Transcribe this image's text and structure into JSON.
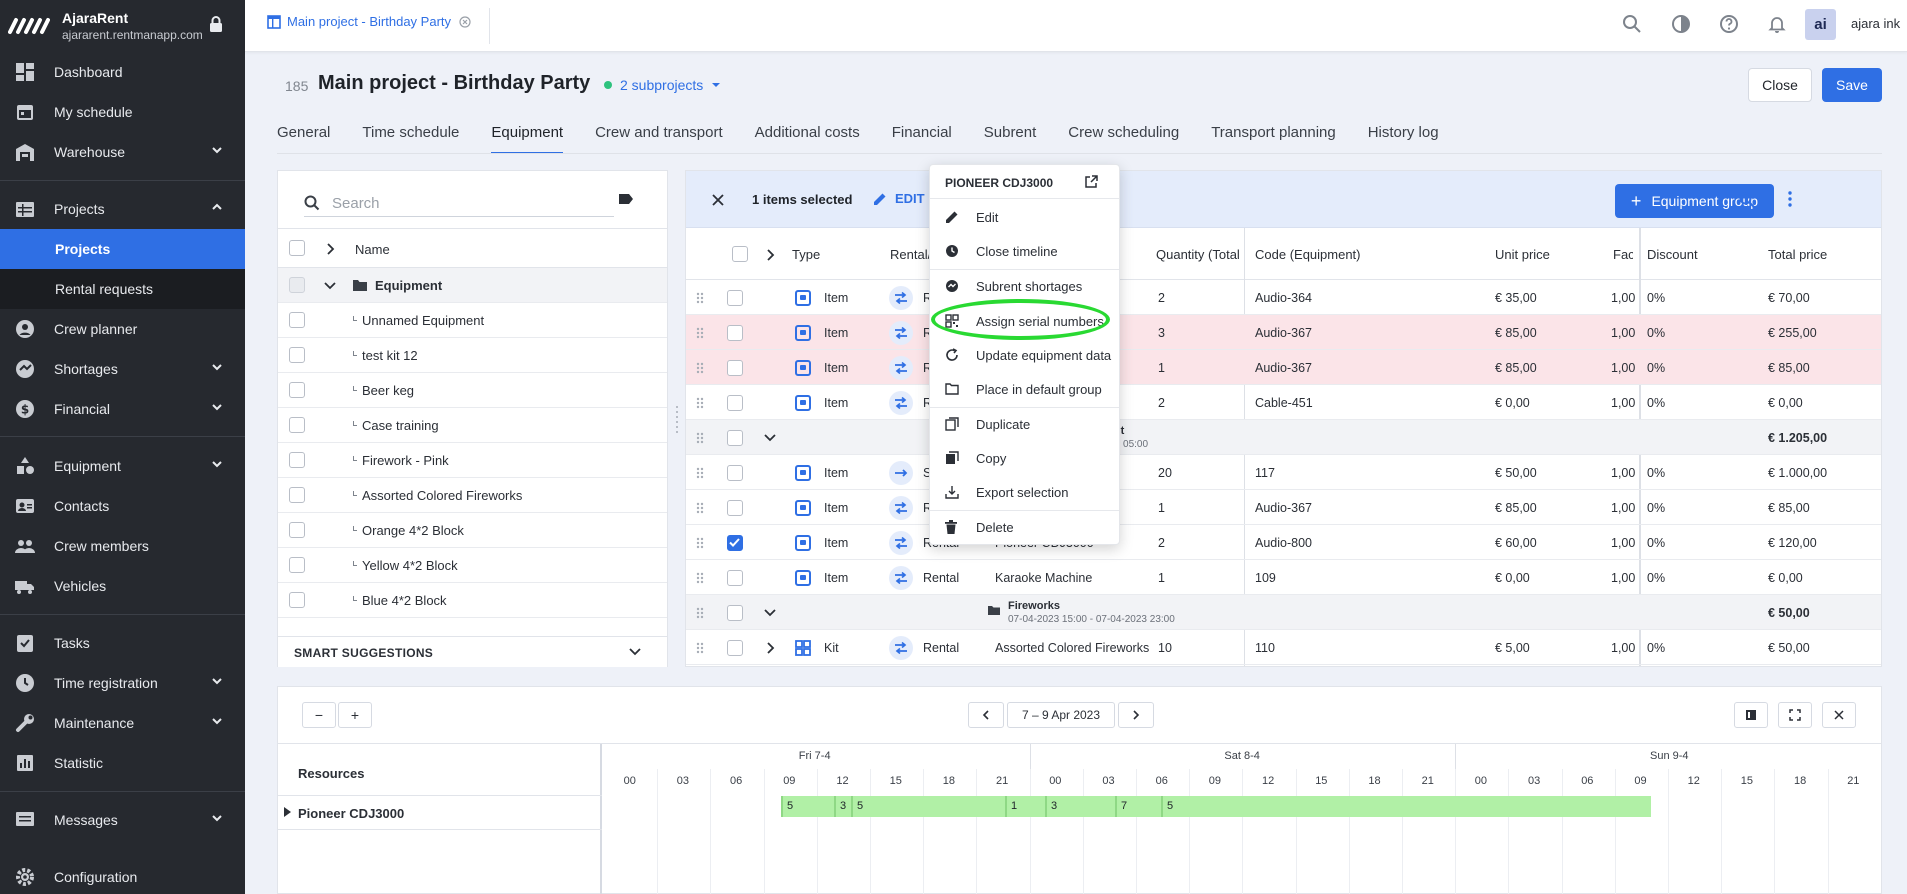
{
  "sidebar": {
    "brand_name": "AjaraRent",
    "brand_url": "ajararent.rentmanapp.com",
    "items": [
      {
        "label": "Dashboard"
      },
      {
        "label": "My schedule"
      },
      {
        "label": "Warehouse"
      },
      {
        "label": "Projects"
      },
      {
        "label": "Projects"
      },
      {
        "label": "Rental requests"
      },
      {
        "label": "Crew planner"
      },
      {
        "label": "Shortages"
      },
      {
        "label": "Financial"
      },
      {
        "label": "Equipment"
      },
      {
        "label": "Contacts"
      },
      {
        "label": "Crew members"
      },
      {
        "label": "Vehicles"
      },
      {
        "label": "Tasks"
      },
      {
        "label": "Time registration"
      },
      {
        "label": "Maintenance"
      },
      {
        "label": "Statistic"
      },
      {
        "label": "Messages"
      },
      {
        "label": "Configuration"
      }
    ]
  },
  "topbar": {
    "open_tab": "Main project - Birthday Party",
    "avatar_initials": "ai",
    "user_name": "ajara ink"
  },
  "project": {
    "number": "185",
    "title": "Main project - Birthday Party",
    "subprojects": "2 subprojects",
    "close_label": "Close",
    "save_label": "Save"
  },
  "tabs": [
    "General",
    "Time schedule",
    "Equipment",
    "Crew and transport",
    "Additional costs",
    "Financial",
    "Subrent",
    "Crew scheduling",
    "Transport planning",
    "History log"
  ],
  "left_panel": {
    "search_placeholder": "Search",
    "header_name": "Name",
    "group": "Equipment",
    "items": [
      "Unnamed Equipment",
      "test kit 12",
      "Beer keg",
      "Case training",
      "Firework - Pink",
      "Assorted Colored Fireworks",
      "Orange 4*2 Block",
      "Yellow 4*2 Block",
      "Blue 4*2 Block"
    ],
    "smart_suggestions": "SMART SUGGESTIONS"
  },
  "selection_bar": {
    "count": "1 items selected",
    "edit": "EDIT",
    "equipment_group_button": "Equipment group"
  },
  "table": {
    "headers": {
      "type": "Type",
      "rental": "Rental/",
      "quantity": "Quantity (Total",
      "code": "Code (Equipment)",
      "unit_price": "Unit price",
      "factor": "Facto",
      "discount": "Discount",
      "total": "Total price"
    },
    "rows": [
      {
        "type": "Item",
        "rental": "R",
        "name": "…",
        "qty": "2",
        "code": "Audio-364",
        "unit": "€ 35,00",
        "factor": "1,00",
        "discount": "0%",
        "total": "€ 70,00",
        "red": false,
        "checked": false
      },
      {
        "type": "Item",
        "rental": "R",
        "name": "",
        "qty": "3",
        "code": "Audio-367",
        "unit": "€ 85,00",
        "factor": "1,00",
        "discount": "0%",
        "total": "€ 255,00",
        "red": true,
        "checked": false
      },
      {
        "type": "Item",
        "rental": "R",
        "name": "",
        "qty": "1",
        "code": "Audio-367",
        "unit": "€ 85,00",
        "factor": "1,00",
        "discount": "0%",
        "total": "€ 85,00",
        "red": true,
        "checked": false
      },
      {
        "type": "Item",
        "rental": "R",
        "name": "",
        "qty": "2",
        "code": "Cable-451",
        "unit": "€ 0,00",
        "factor": "1,00",
        "discount": "0%",
        "total": "€ 0,00",
        "red": false,
        "checked": false
      },
      {
        "group": true,
        "name": "ment",
        "date": "2023 05:00",
        "total": "€ 1.205,00"
      },
      {
        "type": "Item",
        "rental": "S",
        "name": "",
        "qty": "20",
        "code": "117",
        "unit": "€ 50,00",
        "factor": "1,00",
        "discount": "0%",
        "total": "€ 1.000,00",
        "red": false,
        "checked": false
      },
      {
        "type": "Item",
        "rental": "R",
        "name": "",
        "qty": "1",
        "code": "Audio-367",
        "unit": "€ 85,00",
        "factor": "1,00",
        "discount": "0%",
        "total": "€ 85,00",
        "red": false,
        "checked": false
      },
      {
        "type": "Item",
        "rental": "Rental",
        "name": "Pioneer CDJ3000",
        "qty": "2",
        "code": "Audio-800",
        "unit": "€ 60,00",
        "factor": "1,00",
        "discount": "0%",
        "total": "€ 120,00",
        "red": false,
        "checked": true
      },
      {
        "type": "Item",
        "rental": "Rental",
        "name": "Karaoke Machine",
        "qty": "1",
        "code": "109",
        "unit": "€ 0,00",
        "factor": "1,00",
        "discount": "0%",
        "total": "€ 0,00",
        "red": false,
        "checked": false
      },
      {
        "group": true,
        "name": "Fireworks",
        "date": "07-04-2023 15:00 - 07-04-2023 23:00",
        "total": "€ 50,00"
      },
      {
        "type": "Kit",
        "rental": "Rental",
        "name": "Assorted Colored Fireworks",
        "qty": "10",
        "code": "110",
        "unit": "€ 5,00",
        "factor": "1,00",
        "discount": "0%",
        "total": "€ 50,00",
        "red": false,
        "checked": false
      }
    ]
  },
  "context_menu": {
    "title": "PIONEER CDJ3000",
    "items": [
      "Edit",
      "Close timeline",
      "Subrent shortages",
      "Assign serial numbers",
      "Update equipment data",
      "Place in default group",
      "Duplicate",
      "Copy",
      "Export selection",
      "Delete"
    ]
  },
  "timeline": {
    "minus": "−",
    "plus": "+",
    "range": "7 – 9 Apr 2023",
    "resources_label": "Resources",
    "resource": "Pioneer CDJ3000",
    "days": [
      "Fri 7-4",
      "Sat 8-4",
      "Sun 9-4"
    ],
    "hours": [
      "00",
      "03",
      "06",
      "09",
      "12",
      "15",
      "18",
      "21",
      "00",
      "03",
      "06",
      "09",
      "12",
      "15",
      "18",
      "21",
      "00",
      "03",
      "06",
      "09",
      "12",
      "15",
      "18",
      "21"
    ],
    "segments": [
      "5",
      "3",
      "5",
      "1",
      "3",
      "7",
      "5"
    ]
  },
  "colors": {
    "accent": "#2f6fe4",
    "sidebar": "#26292f",
    "shortage_row": "#fbe4e8",
    "timeline_bar": "#b1f0a6",
    "highlight": "#29d932"
  }
}
